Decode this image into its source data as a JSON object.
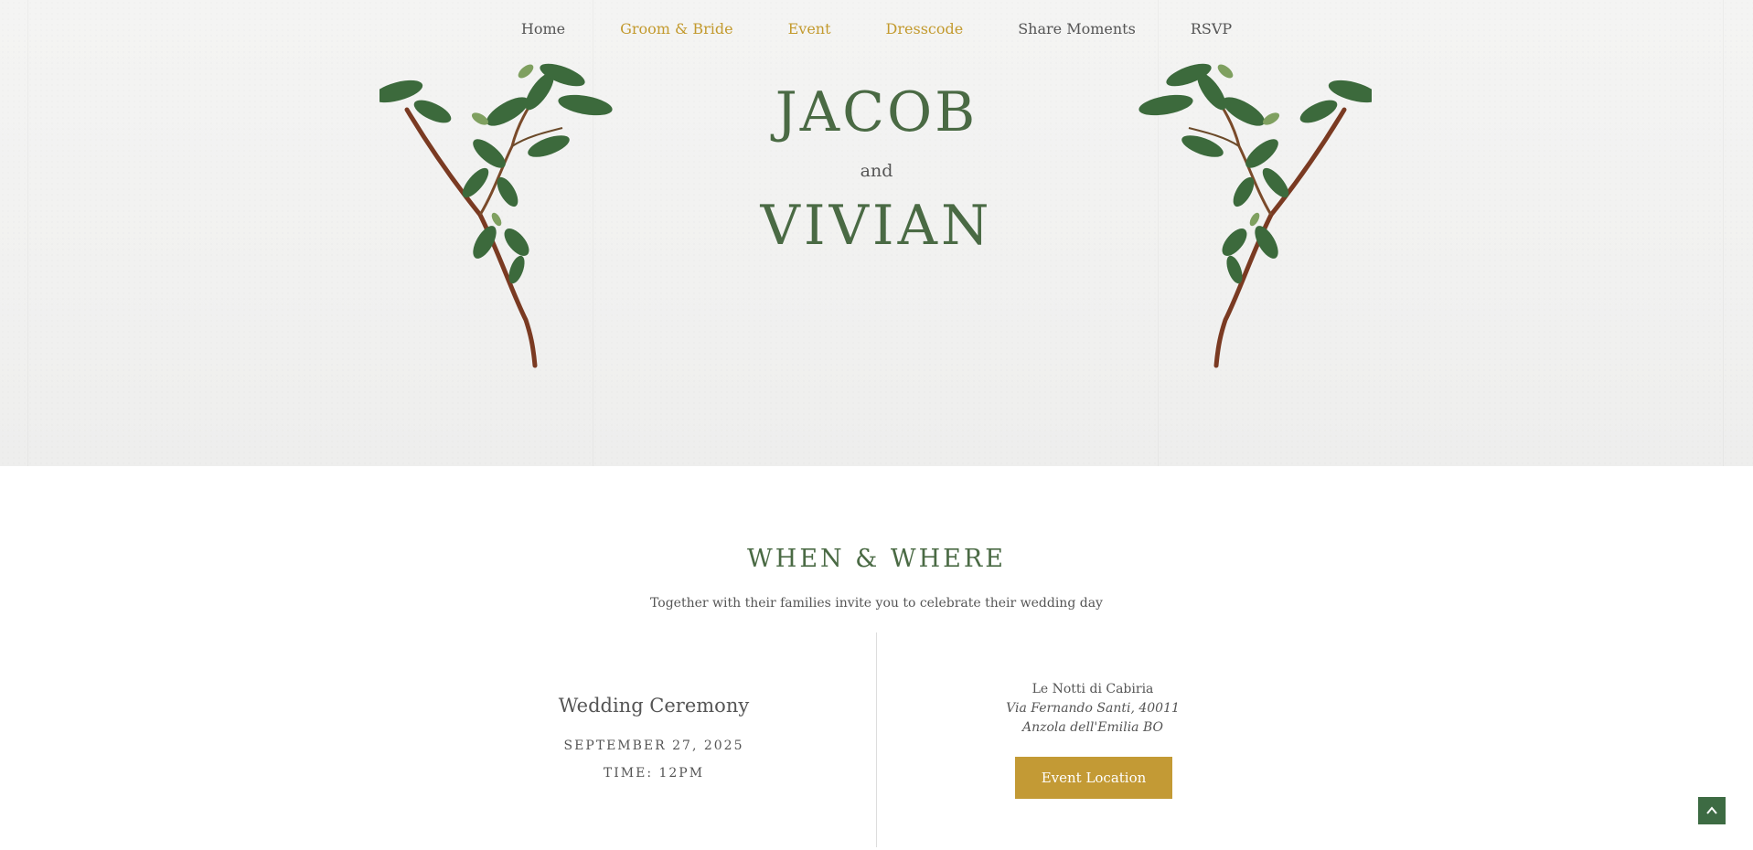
{
  "nav": {
    "items": [
      {
        "label": "Home",
        "active": false
      },
      {
        "label": "Groom & Bride",
        "active": true
      },
      {
        "label": "Event",
        "active": true
      },
      {
        "label": "Dresscode",
        "active": true
      },
      {
        "label": "Share Moments",
        "active": false
      },
      {
        "label": "RSVP",
        "active": false
      }
    ]
  },
  "hero": {
    "name1": "JACOB",
    "conjunction": "and",
    "name2": "VIVIAN"
  },
  "when_where": {
    "title": "WHEN & WHERE",
    "subtitle": "Together with their families invite you to celebrate their wedding day",
    "ceremony": {
      "title": "Wedding Ceremony",
      "date": "SEPTEMBER 27, 2025",
      "time": "TIME: 12PM"
    },
    "venue": {
      "name": "Le Notti di Cabiria",
      "address_line1": "Via Fernando Santi, 40011",
      "address_line2": "Anzola dell'Emilia BO",
      "button_label": "Event Location"
    }
  },
  "icons": {
    "branch_left": "olive-branch-icon",
    "branch_right": "olive-branch-icon",
    "scroll_top": "chevron-up-icon"
  },
  "colors": {
    "accent_green": "#4a6a44",
    "gold": "#c39a2e",
    "button": "#c39a35",
    "scroll_top_bg": "#3d6b43"
  }
}
